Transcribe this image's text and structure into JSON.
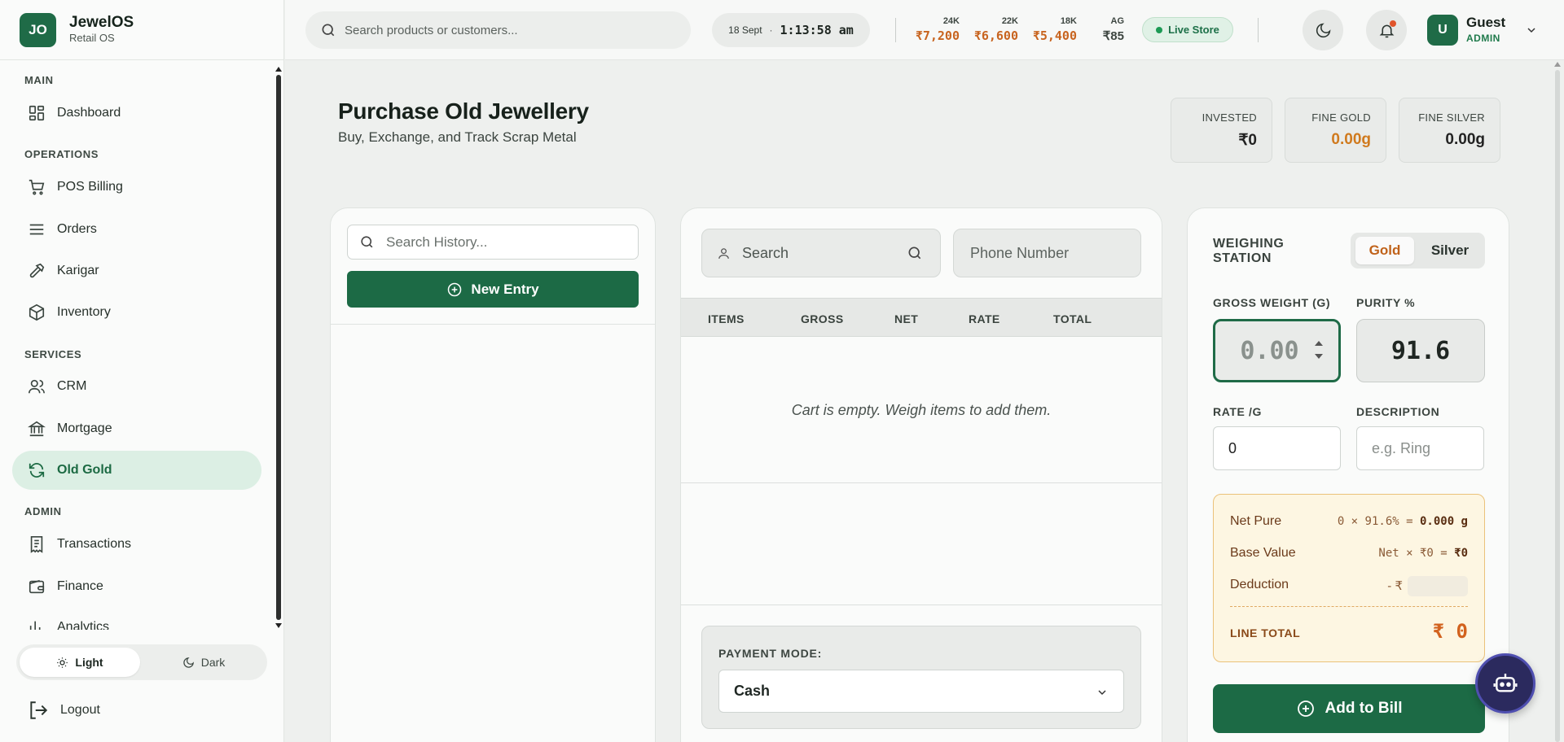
{
  "brand": {
    "logo": "JO",
    "name": "JewelOS",
    "subtitle": "Retail OS",
    "color": "#1f6b47"
  },
  "sidebar": {
    "sections": [
      "MAIN",
      "OPERATIONS",
      "SERVICES",
      "ADMIN"
    ],
    "items": [
      {
        "label": "Dashboard",
        "icon": "grid-icon"
      },
      {
        "label": "POS Billing",
        "icon": "cart-icon"
      },
      {
        "label": "Orders",
        "icon": "list-icon"
      },
      {
        "label": "Karigar",
        "icon": "hammer-icon"
      },
      {
        "label": "Inventory",
        "icon": "box-icon"
      },
      {
        "label": "CRM",
        "icon": "users-icon"
      },
      {
        "label": "Mortgage",
        "icon": "bank-icon"
      },
      {
        "label": "Old Gold",
        "icon": "refresh-icon",
        "active": true
      },
      {
        "label": "Transactions",
        "icon": "receipt-icon"
      },
      {
        "label": "Finance",
        "icon": "wallet-icon"
      },
      {
        "label": "Analytics",
        "icon": "bar-chart-icon"
      }
    ],
    "theme": {
      "light": "Light",
      "dark": "Dark",
      "selected": "Light"
    },
    "logout": "Logout"
  },
  "topbar": {
    "search_placeholder": "Search products or customers...",
    "date": "18 Sept",
    "time": "1:13:58 am",
    "rates": [
      {
        "karat": "24K",
        "value": "₹7,200",
        "color": "#c8641f"
      },
      {
        "karat": "22K",
        "value": "₹6,600",
        "color": "#c8641f"
      },
      {
        "karat": "18K",
        "value": "₹5,400",
        "color": "#c8641f"
      },
      {
        "karat": "AG",
        "value": "₹85",
        "color": "#3d4641"
      }
    ],
    "live_label": "Live Store",
    "user": {
      "initial": "U",
      "name": "Guest",
      "role": "ADMIN"
    }
  },
  "page": {
    "title": "Purchase Old Jewellery",
    "subtitle": "Buy, Exchange, and Track Scrap Metal",
    "stats": [
      {
        "label": "INVESTED",
        "value": "₹0",
        "color": "#222222"
      },
      {
        "label": "FINE GOLD",
        "value": "0.00g",
        "color": "#d07a1e"
      },
      {
        "label": "FINE SILVER",
        "value": "0.00g",
        "color": "#222222"
      }
    ]
  },
  "history": {
    "search_placeholder": "Search History...",
    "new_entry": "New Entry"
  },
  "cart": {
    "customer_placeholder": "Search",
    "phone_placeholder": "Phone Number",
    "columns": [
      "ITEMS",
      "GROSS",
      "NET",
      "RATE",
      "TOTAL"
    ],
    "empty_message": "Cart is empty. Weigh items to add them.",
    "payment_label": "PAYMENT MODE:",
    "payment_value": "Cash"
  },
  "weighing": {
    "title": "WEIGHING STATION",
    "metals": [
      "Gold",
      "Silver"
    ],
    "selected_metal": "Gold",
    "gross_label": "GROSS WEIGHT (G)",
    "gross_value": "0.00",
    "purity_label": "PURITY %",
    "purity_value": "91.6",
    "rate_label": "RATE /G",
    "rate_value": "0",
    "desc_label": "DESCRIPTION",
    "desc_placeholder": "e.g. Ring",
    "calc": {
      "net_pure_label": "Net Pure",
      "net_pure_expr": "0 × 91.6% = ",
      "net_pure_value": "0.000 g",
      "base_value_label": "Base Value",
      "base_value_expr": "Net × ₹0 = ",
      "base_value_value": "₹0",
      "deduction_label": "Deduction",
      "deduction_prefix": "- ₹",
      "line_total_label": "LINE TOTAL",
      "line_total_value": "₹ 0"
    },
    "add_button": "Add to Bill"
  }
}
